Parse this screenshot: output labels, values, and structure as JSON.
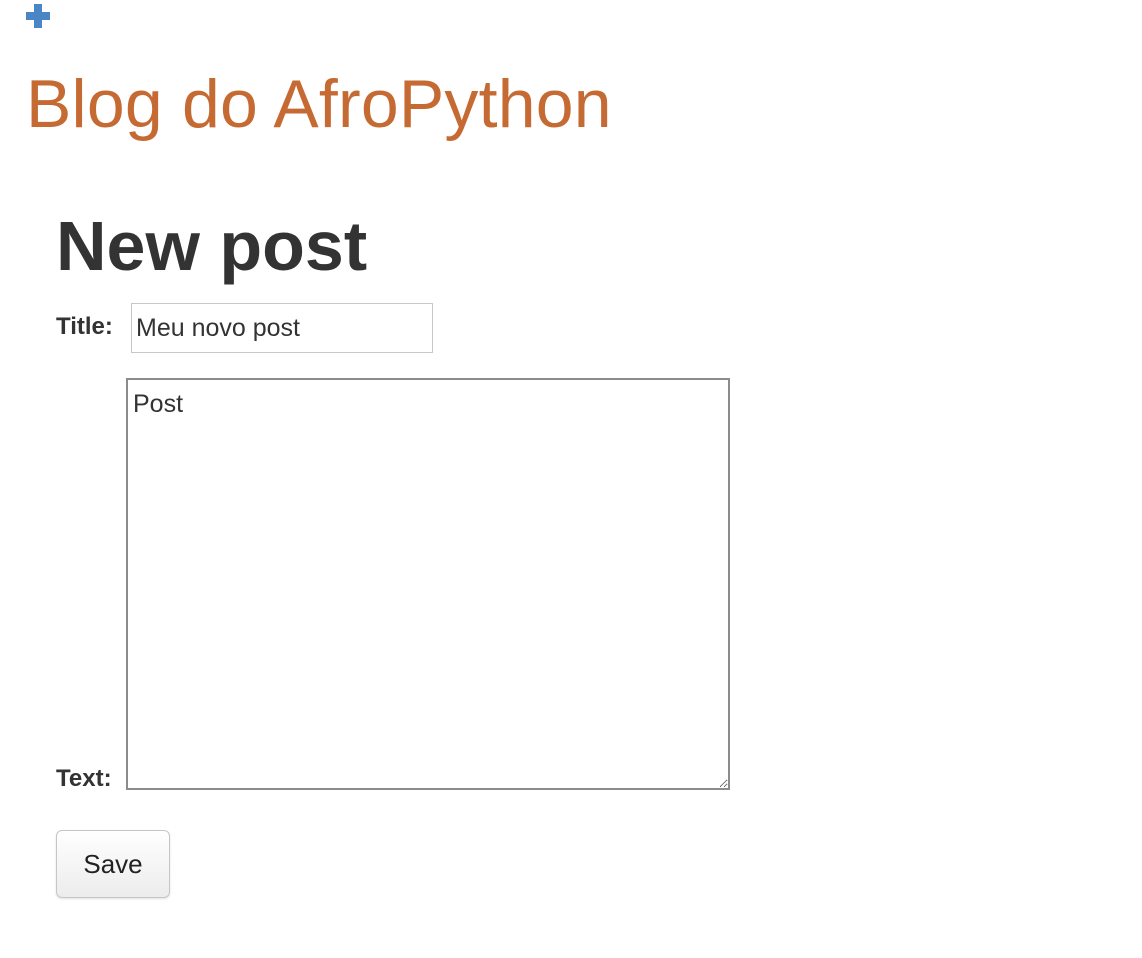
{
  "header": {
    "add_icon": "plus-icon",
    "add_icon_color": "#4A86C5",
    "blog_title": "Blog do AfroPython",
    "blog_title_color": "#C66A33"
  },
  "form": {
    "heading": "New post",
    "title_label": "Title:",
    "title_value": "Meu novo post",
    "text_label": "Text:",
    "text_value": "Post",
    "save_label": "Save"
  }
}
